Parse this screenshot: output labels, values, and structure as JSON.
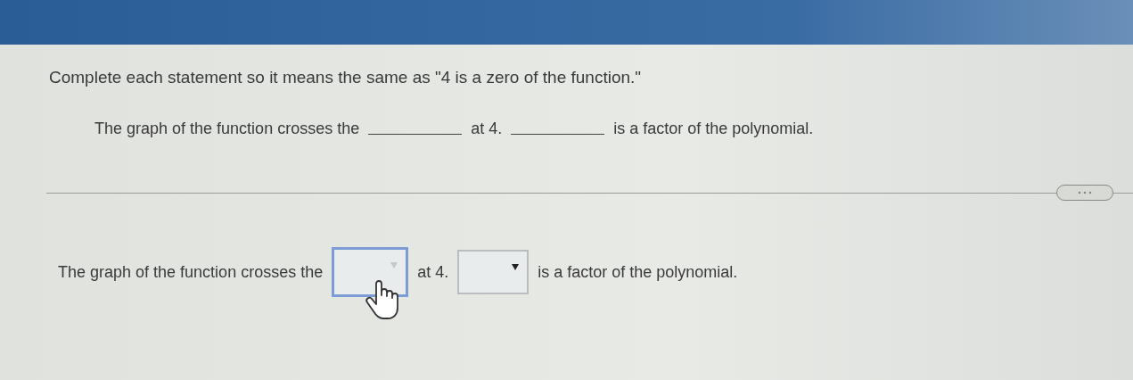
{
  "instruction": "Complete each statement so it means the same as \"4 is a zero of the function.\"",
  "statement": [
    {
      "kind": "text",
      "text": "The graph of the function crosses the"
    },
    {
      "kind": "blank"
    },
    {
      "kind": "text",
      "text": "at 4."
    },
    {
      "kind": "blank"
    },
    {
      "kind": "text",
      "text": "is a factor of the polynomial."
    }
  ],
  "answer": [
    {
      "kind": "text",
      "text": "The graph of the function crosses the"
    },
    {
      "kind": "dropdown",
      "focused": true
    },
    {
      "kind": "text",
      "text": "at 4."
    },
    {
      "kind": "dropdown",
      "focused": false
    },
    {
      "kind": "text",
      "text": "is a factor of the polynomial."
    }
  ]
}
